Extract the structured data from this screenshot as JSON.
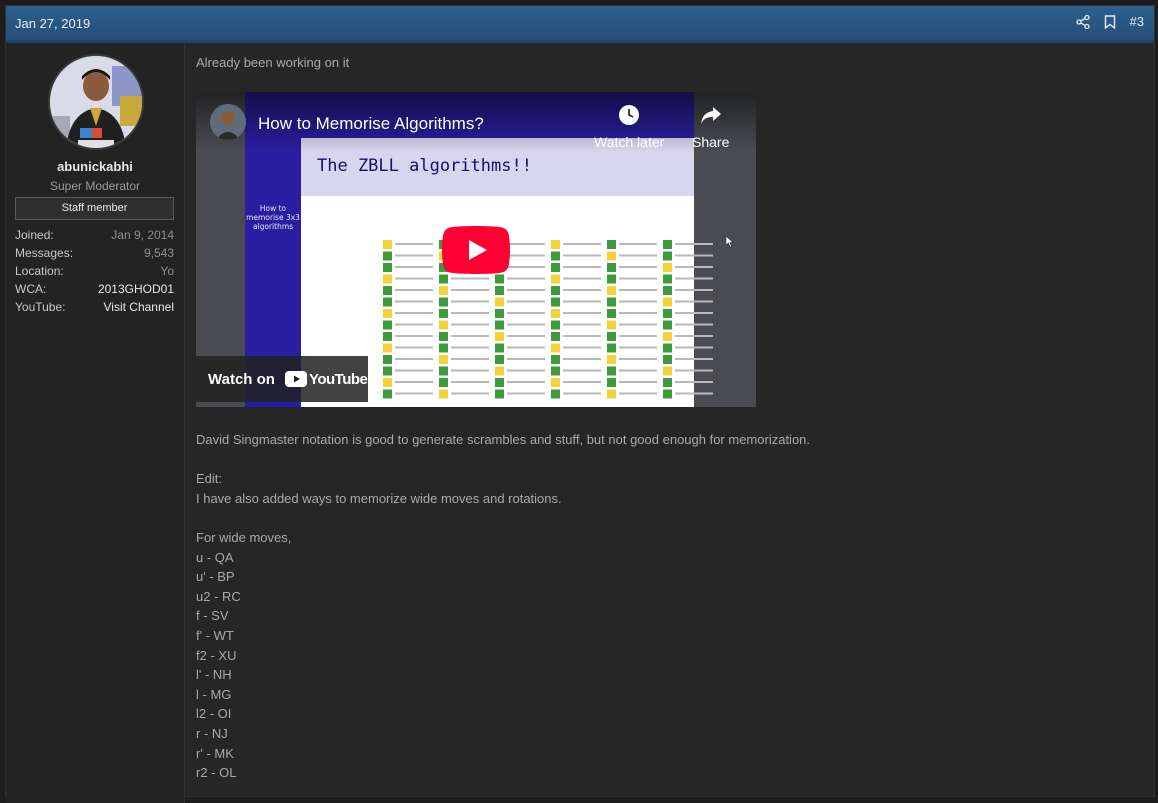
{
  "post": {
    "date": "Jan 27, 2019",
    "number": "#3",
    "icons": [
      "share-icon",
      "bookmark-icon"
    ]
  },
  "user": {
    "name": "abunickabhi",
    "title": "Super Moderator",
    "badge": "Staff member",
    "stats": [
      {
        "label": "Joined:",
        "value": "Jan 9, 2014"
      },
      {
        "label": "Messages:",
        "value": "9,543"
      },
      {
        "label": "Location:",
        "value": "Yo"
      },
      {
        "label": "WCA:",
        "value": "2013GHOD01"
      },
      {
        "label": "YouTube:",
        "value": "Visit Channel"
      }
    ]
  },
  "message": {
    "intro": "Already been working on it",
    "video": {
      "title": "How to Memorise Algorithms?",
      "watch_later": "Watch later",
      "share": "Share",
      "watch_on": "Watch on",
      "youtube": "YouTube",
      "slide_heading": "The ZBLL algorithms!!",
      "slide_side": "How to memorise 3x3 algorithms",
      "slide_tab": "memorise 3x3 algorithms"
    },
    "lines": [
      "David Singmaster notation is good to generate scrambles and stuff, but not good enough for memorization.",
      "",
      "Edit:",
      "I have also added ways to memorize wide moves and rotations.",
      "",
      "For wide moves,",
      "u - QA",
      "u' - BP",
      "u2 - RC",
      "f - SV",
      "f' - WT",
      "f2 - XU",
      "l' - NH",
      "l - MG",
      "l2 - OI",
      "r - NJ",
      "r' - MK",
      "r2 - OL"
    ]
  }
}
